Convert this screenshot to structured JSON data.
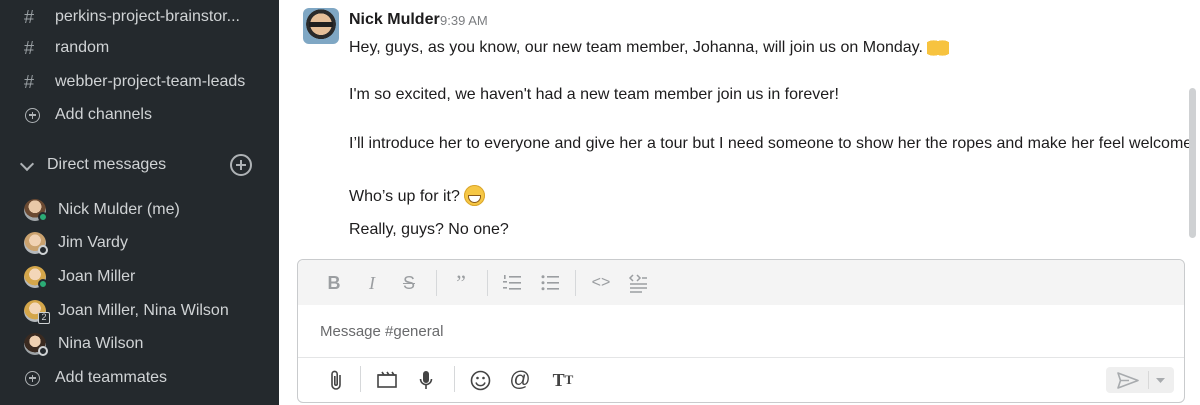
{
  "sidebar": {
    "channels": [
      {
        "name": "perkins-project-brainstor..."
      },
      {
        "name": "random"
      },
      {
        "name": "webber-project-team-leads"
      }
    ],
    "add_channels_label": "Add channels",
    "dm_header": "Direct messages",
    "direct_messages": [
      {
        "name": "Nick Mulder (me)",
        "status": "online"
      },
      {
        "name": "Jim Vardy",
        "status": "away"
      },
      {
        "name": "Joan Miller",
        "status": "online"
      },
      {
        "name": "Joan Miller, Nina Wilson",
        "status": "group",
        "count": "2"
      },
      {
        "name": "Nina Wilson",
        "status": "away"
      }
    ],
    "add_teammates_label": "Add teammates"
  },
  "message": {
    "author": "Nick Mulder",
    "time": "9:39 AM",
    "lines": [
      "Hey, guys, as you know, our new team member, Johanna, will join us on Monday.",
      "I'm so excited, we haven't had a new team member join us in forever!",
      "I’ll introduce her to everyone and give her a tour but I need someone to show her the ropes and make her feel welcome.",
      "Who’s up for it?",
      "Really, guys? No one?"
    ],
    "emojis": [
      "raising-hands-emoji",
      "grinning-emoji"
    ]
  },
  "composer": {
    "placeholder": "Message #general",
    "format_buttons": [
      "bold",
      "italic",
      "strikethrough",
      "quote",
      "ordered-list",
      "bullet-list",
      "code",
      "code-block"
    ],
    "action_buttons": [
      "attach",
      "video",
      "microphone",
      "emoji",
      "mention",
      "text-format"
    ]
  },
  "colors": {
    "sidebar_bg": "#24292d",
    "online": "#2bac76",
    "text": "#1d1c1d"
  }
}
